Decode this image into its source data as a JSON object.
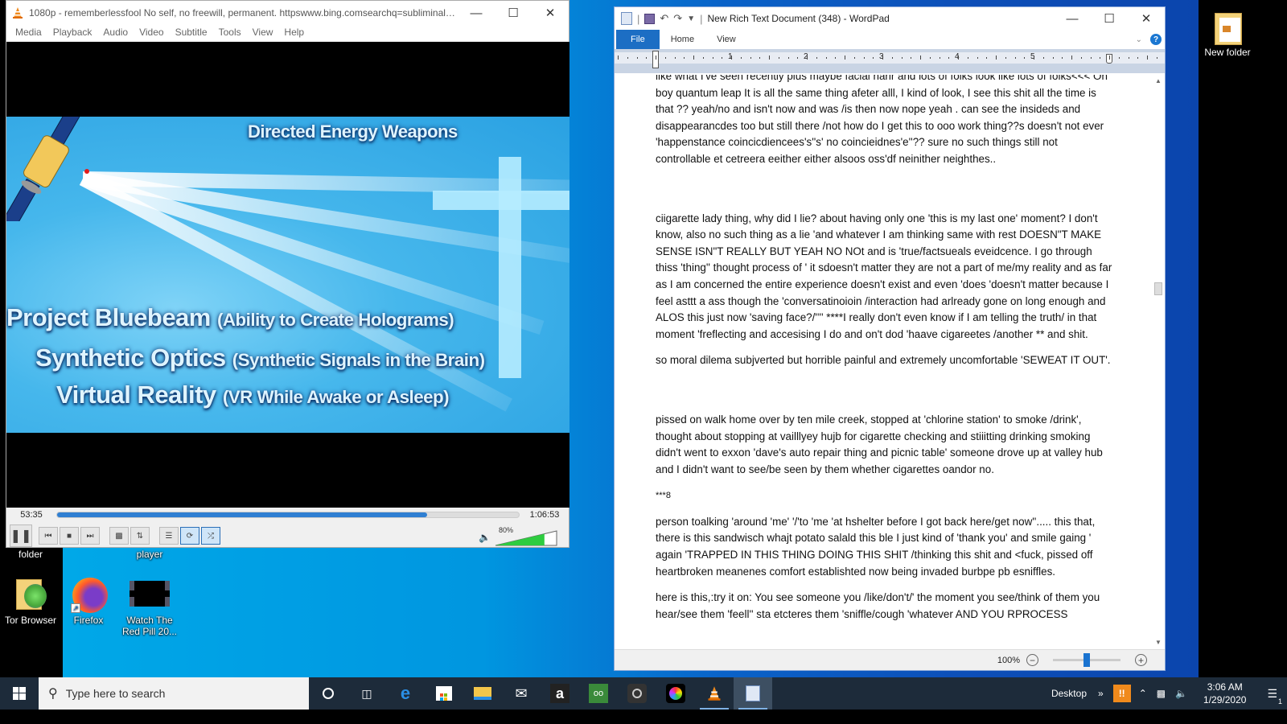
{
  "desktop": {
    "icons": [
      {
        "label": "folder",
        "name": "folder"
      },
      {
        "label": "player",
        "name": "player"
      },
      {
        "label": "Tor Browser",
        "name": "tor-browser"
      },
      {
        "label": "Firefox",
        "name": "firefox"
      },
      {
        "label": "Watch The Red Pill 20...",
        "name": "watch-the-red-pill"
      },
      {
        "label": "New folder",
        "name": "new-folder"
      }
    ]
  },
  "vlc": {
    "title": "1080p - rememberlessfool No self, no freewill, permanent. httpswww.bing.comsearchq=subliminals&...",
    "menu": [
      "Media",
      "Playback",
      "Audio",
      "Video",
      "Subtitle",
      "Tools",
      "View",
      "Help"
    ],
    "video": {
      "heading": "Directed Energy Weapons",
      "lines": [
        {
          "main": "Project Bluebeam",
          "sub": "(Ability to Create Holograms)"
        },
        {
          "main": "Synthetic Optics",
          "sub": "(Synthetic Signals in the Brain)"
        },
        {
          "main": "Virtual Reality",
          "sub": "(VR While Awake or Asleep)"
        }
      ]
    },
    "elapsed": "53:35",
    "total": "1:06:53",
    "progress_fraction": 0.801,
    "volume_label": "80%",
    "volume_fraction": 0.8,
    "loop_active": true,
    "shuffle_active": true
  },
  "wordpad": {
    "title": "New Rich Text Document (348) - WordPad",
    "tabs": [
      "File",
      "Home",
      "View"
    ],
    "ruler_numbers": [
      "1",
      "2",
      "3",
      "4",
      "5"
    ],
    "zoom": "100%",
    "zoom_fraction": 0.5,
    "paragraphs": [
      "like what I've seen recently plus maybe facial harir and lots of folks look like lots of folks<<< Oh boy quantum leap It is all the same thing afeter alll, I kind of look, I see this shit all the time is that ?? yeah/no and isn't now and was /is then now nope yeah . can see the insideds and disappearancdes too but still there /not how do I get this to ooo work thing??s doesn't not ever 'happenstance coincicdiencees's''s' no coincieidnes'e''?? sure no such things still not controllable et cetreera eeither either alsoos oss'df neinither neighthes..",
      "",
      "ciigarette lady thing, why did I lie? about having only one 'this is my last one' moment? I don't know, also no such thing as a lie 'and whatever I am thinking same with rest DOESN\"T MAKE SENSE ISN\"T REALLY BUT YEAH NO NOt and is 'true/factsueals eveidcence. I go through thiss 'thing'' thought process of ' it sdoesn't matter they are not a part of me/my reality and as far as I am concerned the entire experience doesn't exist and even 'does 'doesn't matter because I feel asttt a ass though the 'conversatinoioin /interaction had arlready gone on long enough and ALOS this just now 'saving face?/'''' ****I really don't even know if I am telling the truth/ in that moment 'freflecting and accesising I do and on't dod 'haave cigareetes /another **  and shit.",
      "so moral dilema subjverted but horrible painful and extremely uncomfortable 'SEWEAT IT OUT'.",
      "",
      "pissed on walk home over by ten mile creek, stopped at 'chlorine station' to smoke /drink', thought about stopping at vailllyey hujb for cigarette checking and stiiitting drinking smoking didn't went to exxon 'dave's auto repair thing and picnic table' someone drove up at valley hub and I didn't want to see/be seen by them whether cigarettes oandor no.",
      "***8",
      "person toalking 'around 'me' '/'to 'me 'at hshelter before I got back here/get now''..... this that, there is this sandwisch whajt potato salald this ble I just kind of 'thank you' and smile gaing ' again 'TRAPPED IN THIS THING DOING THIS SHIT /thinking this shit and <fuck, pissed off heartbroken meanenes comfort establishted now being invaded burbpe pb esniffles.",
      "here is this,:try it on: You see someone you /like/don't/' the moment you see/think of them you hear/see them 'feell'' sta etcteres them 'sniffle/cough 'whatever AND YOU RPROCESS"
    ]
  },
  "taskbar": {
    "search_placeholder": "Type here to search",
    "apps": [
      "cortana",
      "task-view",
      "edge",
      "store",
      "file-explorer",
      "mail",
      "amazon",
      "tripadvisor",
      "camera",
      "chrome-like",
      "vlc",
      "wordpad"
    ],
    "desktop_label": "Desktop",
    "time": "3:06 AM",
    "date": "1/29/2020",
    "notification_count": "1"
  },
  "colors": {
    "accent": "#1c6ec4",
    "seek_fill": "#2f7fd2",
    "volume_fill": "#2ecc40",
    "taskbar": "#1d2b3a"
  }
}
